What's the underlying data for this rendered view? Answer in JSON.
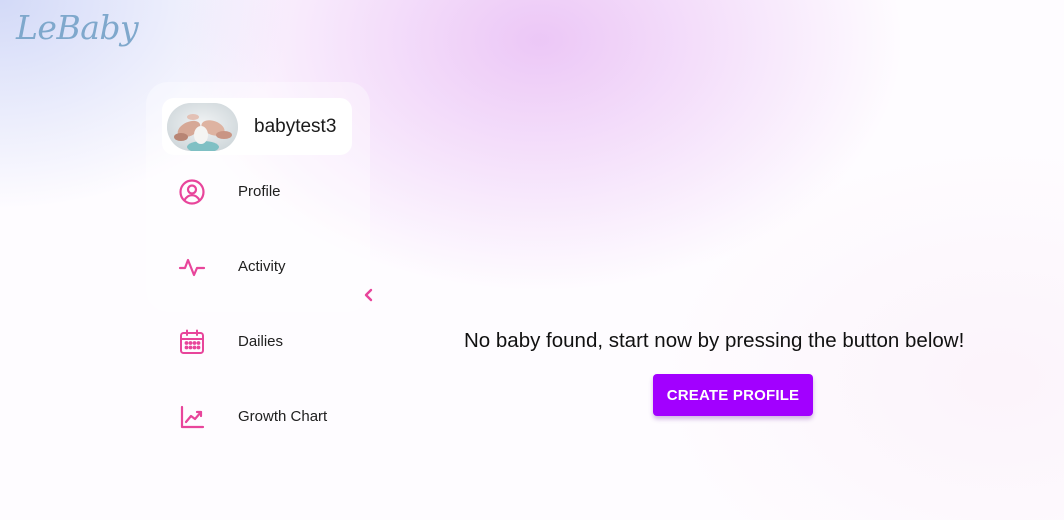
{
  "app": {
    "logo_text": "LeBaby"
  },
  "sidebar": {
    "user": {
      "name": "babytest3",
      "avatar_image": "baby-feet-photo"
    },
    "items": [
      {
        "label": "Profile",
        "icon": "user-circle-icon"
      },
      {
        "label": "Activity",
        "icon": "activity-pulse-icon"
      },
      {
        "label": "Dailies",
        "icon": "calendar-icon"
      },
      {
        "label": "Growth Chart",
        "icon": "line-chart-icon"
      }
    ],
    "collapse_icon": "chevron-left-icon"
  },
  "main": {
    "empty_message": "No baby found, start now by pressing the button below!",
    "create_button_label": "CREATE PROFILE"
  },
  "colors": {
    "accent_pink": "#e8459b",
    "button_purple": "#a200ff",
    "logo_blue": "#7fa8cc"
  }
}
